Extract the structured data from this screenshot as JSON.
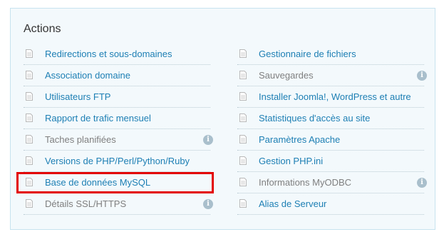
{
  "panel": {
    "title": "Actions",
    "left_column": [
      {
        "label": "Redirections et sous-domaines",
        "enabled": true
      },
      {
        "label": "Association domaine",
        "enabled": true
      },
      {
        "label": "Utilisateurs FTP",
        "enabled": true
      },
      {
        "label": "Rapport de trafic mensuel",
        "enabled": true
      },
      {
        "label": "Taches planifiées",
        "enabled": false,
        "info_icon": "info-icon"
      },
      {
        "label": "Versions de PHP/Perl/Python/Ruby",
        "enabled": true
      },
      {
        "label": "Base de données MySQL",
        "enabled": true,
        "highlighted": true
      },
      {
        "label": "Détails SSL/HTTPS",
        "enabled": false,
        "info_icon": "info-icon"
      }
    ],
    "right_column": [
      {
        "label": "Gestionnaire de fichiers",
        "enabled": true
      },
      {
        "label": "Sauvegardes",
        "enabled": false,
        "info_icon": "info-icon"
      },
      {
        "label": "Installer Joomla!, WordPress et autre",
        "enabled": true
      },
      {
        "label": "Statistiques d'accès au site",
        "enabled": true
      },
      {
        "label": "Paramètres Apache",
        "enabled": true
      },
      {
        "label": "Gestion PHP.ini",
        "enabled": true
      },
      {
        "label": "Informations MyODBC",
        "enabled": false,
        "info_icon": "info-icon"
      },
      {
        "label": "Alias de Serveur",
        "enabled": true
      }
    ]
  },
  "info_icon_glyph": "i",
  "colors": {
    "link": "#1d7fb4",
    "disabled": "#7f7f7f",
    "panel_bg": "#f3f9fc",
    "panel_border": "#c7e3ef",
    "highlight": "#e30000"
  }
}
